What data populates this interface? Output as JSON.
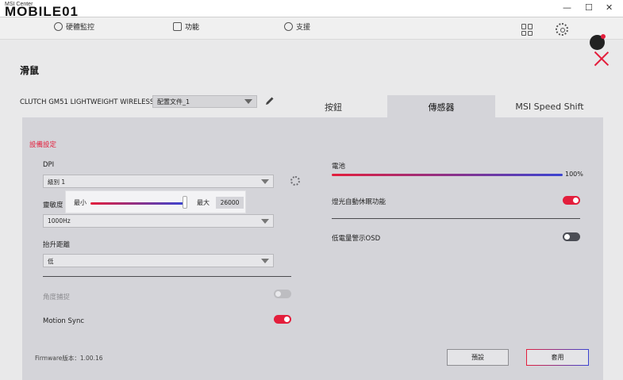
{
  "window": {
    "app_name": "MSI Center",
    "watermark": "MOBILE01",
    "minimize": "—",
    "maximize": "☐",
    "close": "✕"
  },
  "nav": {
    "items": [
      {
        "label": "硬體監控",
        "icon": "monitor-icon",
        "active": false
      },
      {
        "label": "功能",
        "icon": "features-icon",
        "active": true
      },
      {
        "label": "支援",
        "icon": "support-icon",
        "active": false
      }
    ]
  },
  "page": {
    "title": "滑鼠",
    "device_name": "CLUTCH GM51 LIGHTWEIGHT WIRELESS",
    "profile_selected": "配置文件_1"
  },
  "tabs": [
    {
      "label": "按鈕",
      "active": false
    },
    {
      "label": "傳感器",
      "active": true
    },
    {
      "label": "MSI Speed Shift",
      "active": false
    }
  ],
  "settings": {
    "section_title": "設備設定",
    "dpi": {
      "label": "DPI",
      "selected": "級別 1"
    },
    "sensitivity": {
      "label": "靈敏度",
      "min_label": "最小",
      "max_label": "最大",
      "value": "26000",
      "level": 0.95
    },
    "polling": {
      "selected": "1000Hz"
    },
    "lift_off": {
      "label": "抬升距離",
      "selected": "低"
    },
    "angle_snap": {
      "label": "角度捕捉",
      "state": "disabled"
    },
    "motion_sync": {
      "label": "Motion Sync",
      "state": "on"
    },
    "firmware": "Firmware版本：1.00.16"
  },
  "battery": {
    "label": "電池",
    "percent": "100%",
    "level": 1.0
  },
  "sleep": {
    "label": "燈光自動休眠功能",
    "state": "on"
  },
  "low_battery_osd": {
    "label": "低電量警示OSD",
    "state": "off"
  },
  "buttons": {
    "default": "預設",
    "apply": "套用"
  },
  "colors": {
    "accent_red": "#e31e3c",
    "accent_blue": "#3a43d1",
    "panel": "#d4d4d9"
  }
}
